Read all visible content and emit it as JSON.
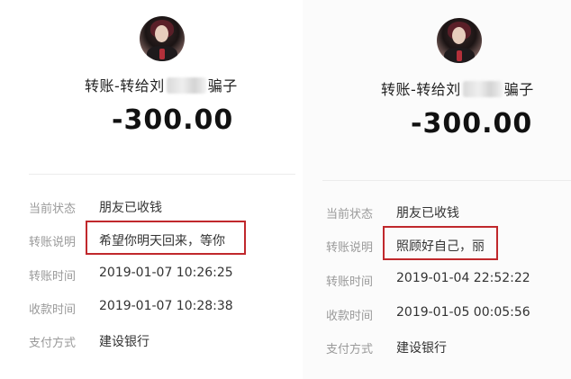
{
  "colors": {
    "highlight_border": "#c0282c",
    "label_text": "#9a9a9a",
    "value_text": "#333333",
    "amount_text": "#111111"
  },
  "left": {
    "title": "转账-转给刘",
    "title_suffix": "骗子",
    "amount": "-300.00",
    "rows": [
      {
        "label": "当前状态",
        "value": "朋友已收钱"
      },
      {
        "label": "转账说明",
        "value": "希望你明天回来，等你"
      },
      {
        "label": "转账时间",
        "value": "2019-01-07 10:26:25"
      },
      {
        "label": "收款时间",
        "value": "2019-01-07 10:28:38"
      },
      {
        "label": "支付方式",
        "value": "建设银行"
      }
    ]
  },
  "right": {
    "title": "转账-转给刘",
    "title_suffix": "骗子",
    "amount": "-300.00",
    "rows": [
      {
        "label": "当前状态",
        "value": "朋友已收钱"
      },
      {
        "label": "转账说明",
        "value": "照顾好自己，丽"
      },
      {
        "label": "转账时间",
        "value": "2019-01-04 22:52:22"
      },
      {
        "label": "收款时间",
        "value": "2019-01-05 00:05:56"
      },
      {
        "label": "支付方式",
        "value": "建设银行"
      }
    ]
  }
}
